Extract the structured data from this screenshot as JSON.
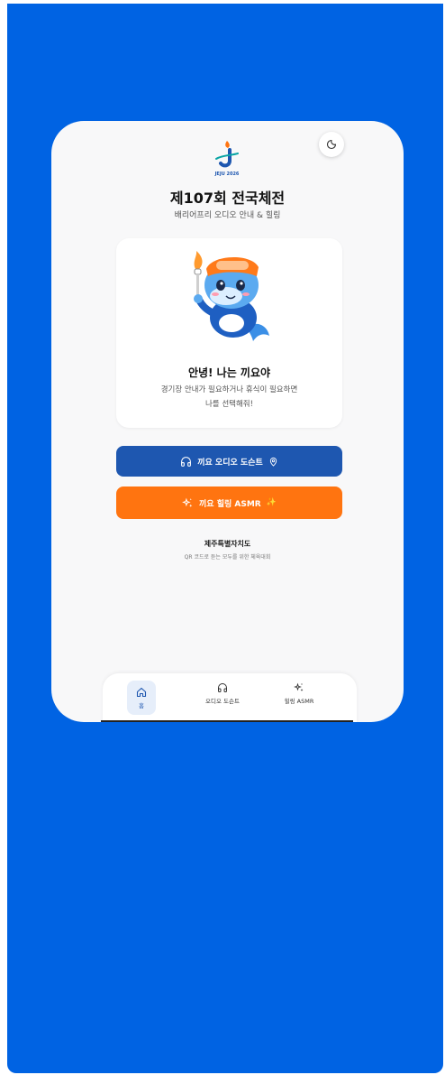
{
  "header": {
    "logo_text": "JEJU 2026",
    "title": "제107회 전국체전",
    "subtitle": "배리어프리 오디오 안내 & 힐링"
  },
  "mascot": {
    "greeting": "안녕! 나는 끼요야",
    "description_line1": "경기장 안내가 필요하거나 휴식이 필요하면",
    "description_line2": "나를 선택해줘!"
  },
  "buttons": {
    "audio_label": "끼요 오디오 도슨트",
    "healing_label": "끼요 힐링 ASMR",
    "audio_color": "#1E57B0",
    "healing_color": "#FF7410"
  },
  "footer": {
    "organization": "제주특별자치도",
    "tagline": "QR 코드로 듣는 모두를 위한 체육대회"
  },
  "nav": {
    "home": "홈",
    "audio": "오디오 도슨트",
    "asmr": "힐링 ASMR"
  },
  "colors": {
    "background": "#0063E3",
    "accent": "#1E57B0",
    "orange": "#FF7410"
  }
}
